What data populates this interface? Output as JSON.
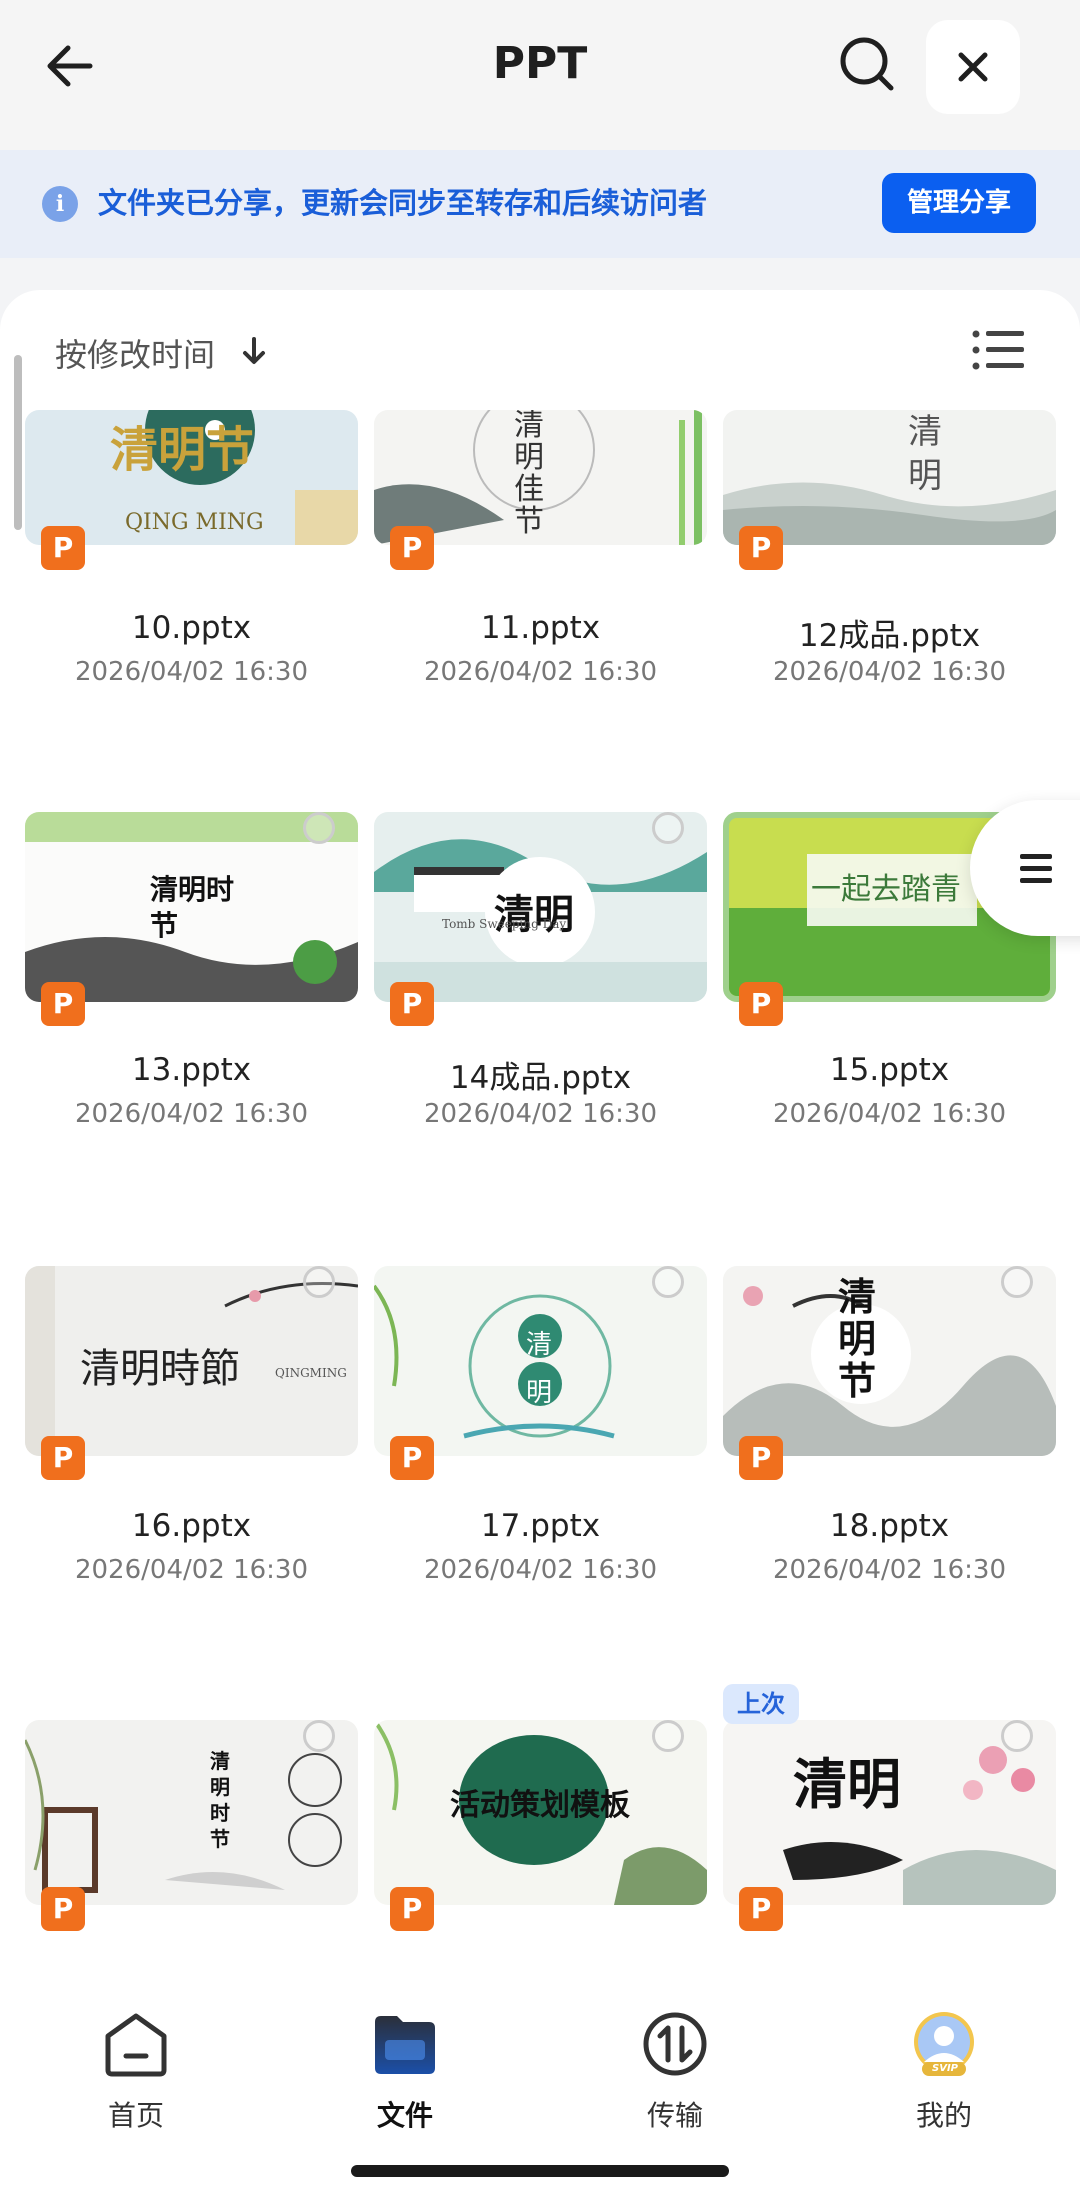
{
  "header": {
    "title": "PPT"
  },
  "banner": {
    "text": "文件夹已分享，更新会同步至转存和后续访问者",
    "manage_label": "管理分享"
  },
  "sort": {
    "label": "按修改时间"
  },
  "files": [
    {
      "name": "10.pptx",
      "date": "2026/04/02 16:30",
      "thumb_text": "清明节",
      "thumb_sub": "QING MING"
    },
    {
      "name": "11.pptx",
      "date": "2026/04/02 16:30",
      "thumb_text": "清明佳节",
      "thumb_sub": ""
    },
    {
      "name": "12成品.pptx",
      "date": "2026/04/02 16:30",
      "thumb_text": "清明",
      "thumb_sub": ""
    },
    {
      "name": "13.pptx",
      "date": "2026/04/02 16:30",
      "thumb_text": "清明时节",
      "thumb_sub": ""
    },
    {
      "name": "14成品.pptx",
      "date": "2026/04/02 16:30",
      "thumb_text": "清明",
      "thumb_sub": "Tomb Sweeping Day"
    },
    {
      "name": "15.pptx",
      "date": "2026/04/02 16:30",
      "thumb_text": "一起去踏青",
      "thumb_sub": ""
    },
    {
      "name": "16.pptx",
      "date": "2026/04/02 16:30",
      "thumb_text": "清明時節",
      "thumb_sub": "QINGMING"
    },
    {
      "name": "17.pptx",
      "date": "2026/04/02 16:30",
      "thumb_text": "清明",
      "thumb_sub": ""
    },
    {
      "name": "18.pptx",
      "date": "2026/04/02 16:30",
      "thumb_text": "清明节",
      "thumb_sub": ""
    },
    {
      "name": "",
      "date": "",
      "thumb_text": "清明时节",
      "thumb_sub": ""
    },
    {
      "name": "",
      "date": "",
      "thumb_text": "活动策划模板",
      "thumb_sub": ""
    },
    {
      "name": "",
      "date": "",
      "thumb_text": "清明",
      "thumb_sub": "",
      "badge": "上次"
    }
  ],
  "file_badge": "P",
  "nav": [
    {
      "label": "首页",
      "icon": "home-icon"
    },
    {
      "label": "文件",
      "icon": "folder-icon"
    },
    {
      "label": "传输",
      "icon": "transfer-icon"
    },
    {
      "label": "我的",
      "icon": "avatar-icon",
      "badge": "SVIP"
    }
  ],
  "colors": {
    "accent": "#0b5ff0",
    "badge_orange": "#f06f1d",
    "banner_bg": "#e9eef8"
  }
}
